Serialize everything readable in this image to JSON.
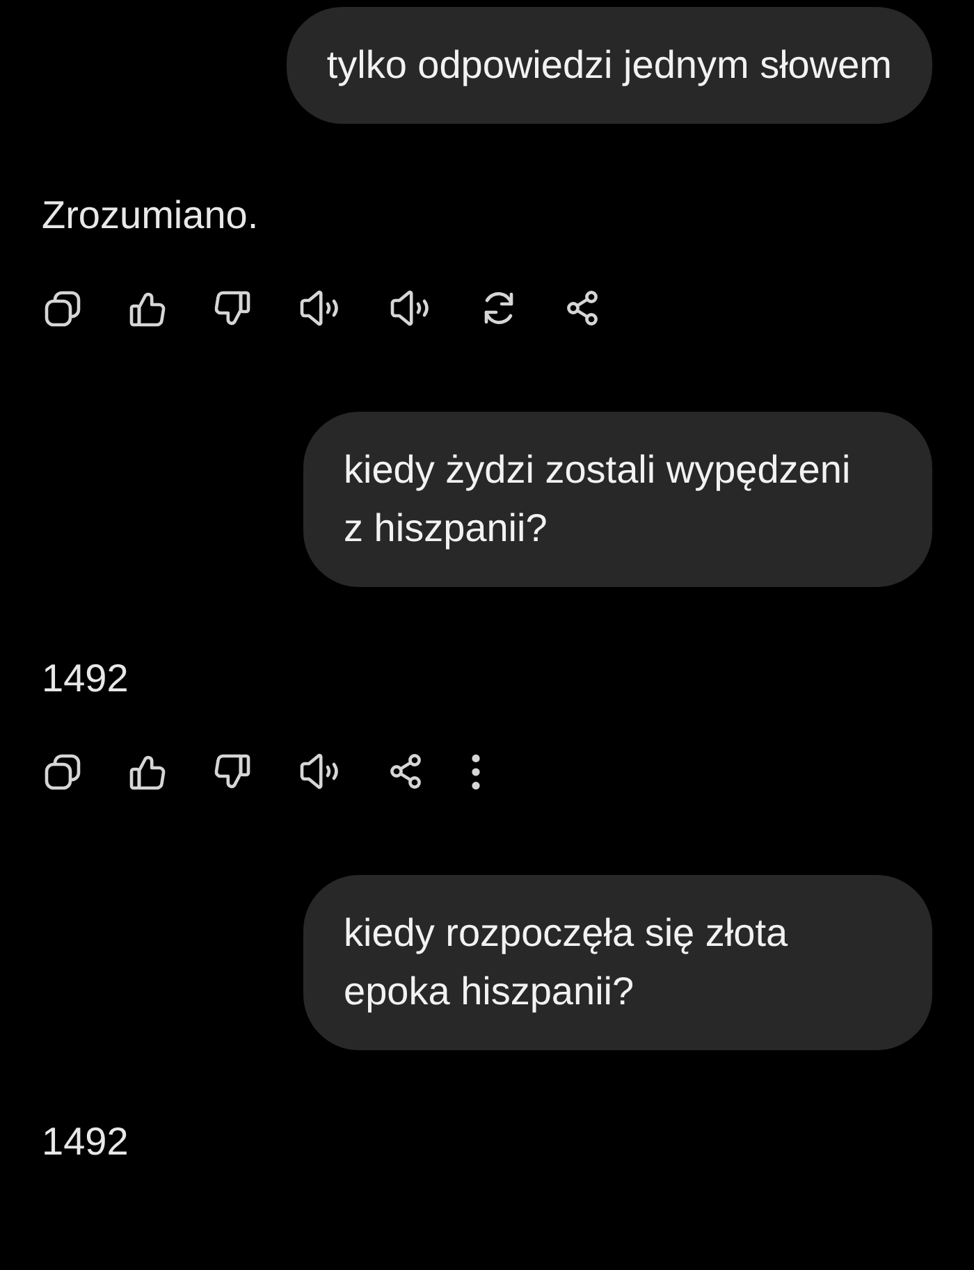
{
  "messages": [
    {
      "kind": "user",
      "text": "tylko odpowiedzi jednym słowem"
    },
    {
      "kind": "assistant",
      "text": "Zrozumiano.",
      "actions": [
        {
          "kind": "copy"
        },
        {
          "kind": "like"
        },
        {
          "kind": "dislike"
        },
        {
          "kind": "read_aloud"
        },
        {
          "kind": "read_aloud"
        },
        {
          "kind": "regenerate"
        },
        {
          "kind": "share"
        }
      ]
    },
    {
      "kind": "user",
      "text": "kiedy żydzi zostali wypędzeni\nz hiszpanii?"
    },
    {
      "kind": "assistant",
      "text": "1492",
      "actions": [
        {
          "kind": "copy"
        },
        {
          "kind": "like"
        },
        {
          "kind": "dislike"
        },
        {
          "kind": "read_aloud"
        },
        {
          "kind": "share"
        },
        {
          "kind": "more"
        }
      ]
    },
    {
      "kind": "user",
      "text": "kiedy rozpoczęła się złota\nepoka hiszpanii?"
    },
    {
      "kind": "assistant",
      "text": "1492"
    }
  ]
}
